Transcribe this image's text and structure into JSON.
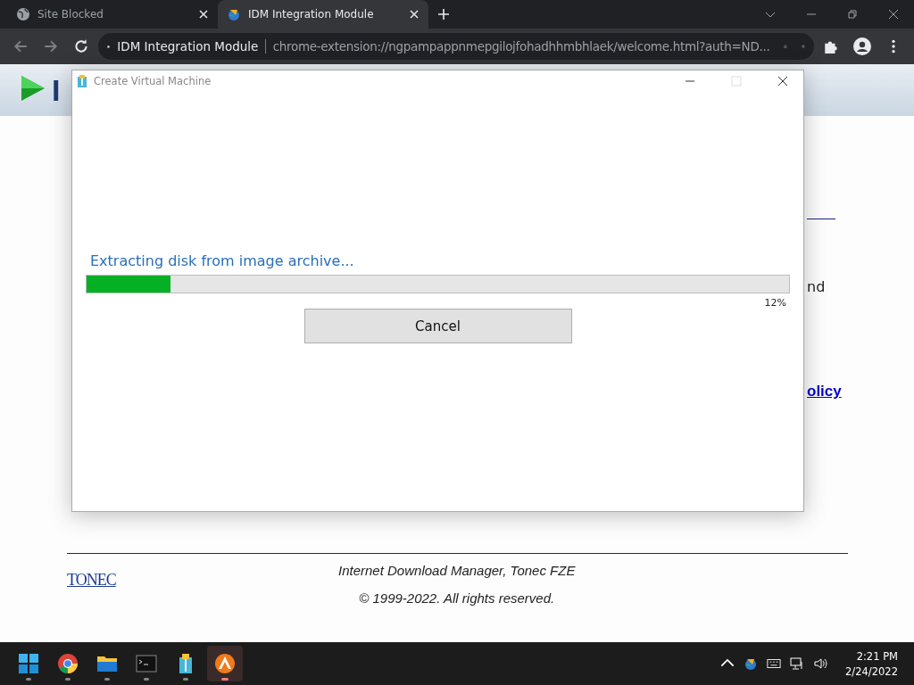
{
  "browser": {
    "tabs": [
      {
        "title": "Site Blocked",
        "selected": false
      },
      {
        "title": "IDM Integration Module",
        "selected": true
      }
    ],
    "address_bar": {
      "site": "IDM Integration Module",
      "url": "chrome-extension://ngpampappnmepgilojfohadhhmbhlaek/welcome.html?auth=ND..."
    }
  },
  "page": {
    "header_logo_text": "I",
    "text_fragment": "nd",
    "link_fragment": "olicy",
    "footer_lines": [
      "Internet Download Manager, Tonec FZE",
      "© 1999-2022. All rights reserved."
    ],
    "footer_logo": "TONEC"
  },
  "dialog": {
    "title": "Create Virtual Machine",
    "status": "Extracting disk from image archive...",
    "level": 0.12,
    "percent": "12%",
    "button": "Cancel"
  },
  "taskbar": {
    "apps": [
      {
        "kind": "start",
        "active": false
      },
      {
        "kind": "chrome",
        "active": false
      },
      {
        "kind": "folder",
        "active": false
      },
      {
        "kind": "terminal",
        "active": false
      },
      {
        "kind": "archive",
        "active": false
      },
      {
        "kind": "launcher",
        "active": true
      }
    ],
    "time": "2:21 PM",
    "date": "2/24/2022"
  }
}
